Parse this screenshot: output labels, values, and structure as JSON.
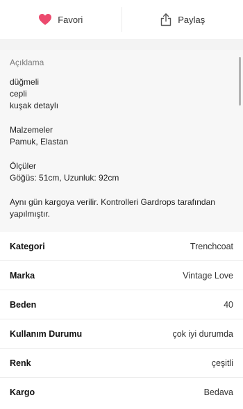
{
  "actions": {
    "favorite_label": "Favori",
    "share_label": "Paylaş",
    "favorite_color": "#ec4a6e"
  },
  "description": {
    "title": "Açıklama",
    "features": [
      "düğmeli",
      "cepli",
      "kuşak detaylı"
    ],
    "materials_title": "Malzemeler",
    "materials_value": "Pamuk, Elastan",
    "measurements_title": "Ölçüler",
    "measurements_value": "Göğüs: 51cm, Uzunluk: 92cm",
    "shipping_note_line1": "Aynı gün kargoya verilir. Kontrolleri Gardrops tarafından",
    "shipping_note_line2": "yapılmıştır."
  },
  "attributes": [
    {
      "label": "Kategori",
      "value": "Trenchcoat"
    },
    {
      "label": "Marka",
      "value": "Vintage Love"
    },
    {
      "label": "Beden",
      "value": "40"
    },
    {
      "label": "Kullanım Durumu",
      "value": "çok iyi durumda"
    },
    {
      "label": "Renk",
      "value": "çeşitli"
    },
    {
      "label": "Kargo",
      "value": "Bedava"
    }
  ]
}
